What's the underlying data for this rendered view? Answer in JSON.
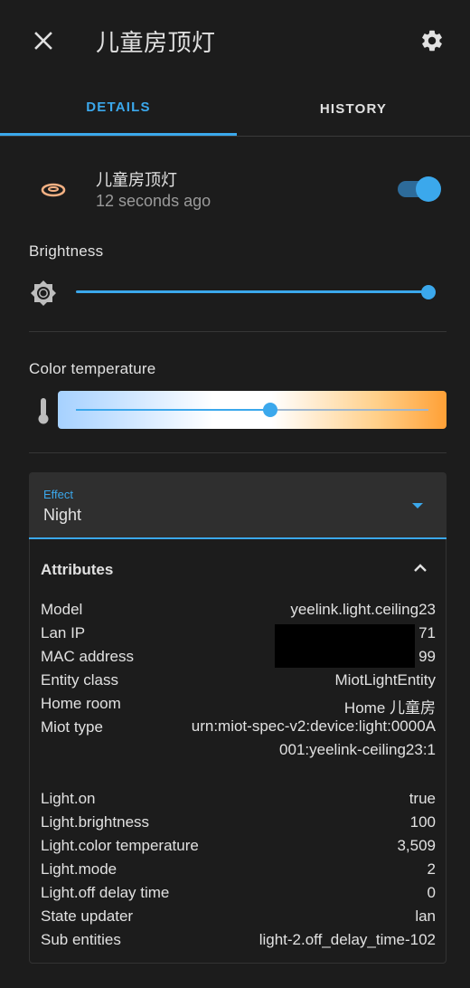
{
  "header": {
    "title": "儿童房顶灯",
    "close_icon": "close-icon",
    "settings_icon": "gear-icon"
  },
  "tabs": [
    {
      "label": "DETAILS",
      "active": true
    },
    {
      "label": "HISTORY",
      "active": false
    }
  ],
  "entity": {
    "name": "儿童房顶灯",
    "last_changed": "12 seconds ago",
    "icon": "ceiling-light-icon",
    "icon_color": "#f4b183",
    "state_on": true
  },
  "brightness": {
    "label": "Brightness",
    "icon": "brightness-icon",
    "value": 100
  },
  "color_temperature": {
    "label": "Color temperature",
    "icon": "thermometer-icon",
    "position_fraction": 0.55
  },
  "effect": {
    "label": "Effect",
    "value": "Night"
  },
  "attributes": {
    "title": "Attributes",
    "rows": [
      {
        "key": "Model",
        "value": "yeelink.light.ceiling23"
      },
      {
        "key": "Lan IP",
        "value": "71"
      },
      {
        "key": "MAC address",
        "value": "99"
      },
      {
        "key": "Entity class",
        "value": "MiotLightEntity"
      },
      {
        "key": "Home room",
        "value": "Home 儿童房"
      },
      {
        "key": "Miot type",
        "value": "urn:miot-spec-v2:device:light:0000A001:yeelink-ceiling23:1"
      },
      {
        "key": "Light.on",
        "value": "true"
      },
      {
        "key": "Light.brightness",
        "value": "100"
      },
      {
        "key": "Light.color temperature",
        "value": "3,509"
      },
      {
        "key": "Light.mode",
        "value": "2"
      },
      {
        "key": "Light.off delay time",
        "value": "0"
      },
      {
        "key": "State updater",
        "value": "lan"
      },
      {
        "key": "Sub entities",
        "value": "light-2.off_delay_time-102"
      }
    ]
  },
  "colors": {
    "accent": "#3ba8ec",
    "background": "#1c1c1c",
    "text": "#e1e1e1",
    "secondary_text": "#9a9a9a"
  }
}
